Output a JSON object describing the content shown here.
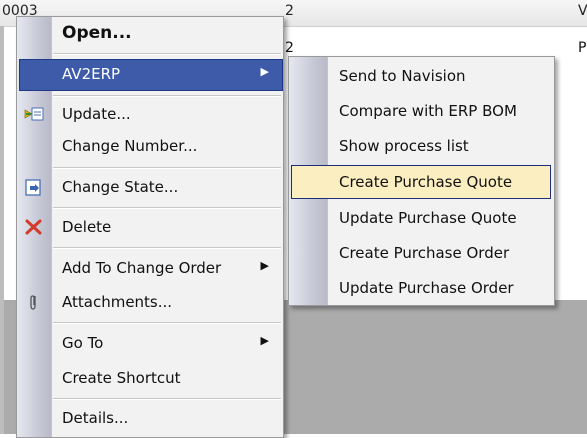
{
  "background": {
    "header_cells": [
      "0003",
      "2",
      "V"
    ],
    "row_texts": [
      "2",
      "P"
    ]
  },
  "context_menu": {
    "items": [
      {
        "label": "Open...",
        "icon": null,
        "bold": true
      },
      {
        "label": "AV2ERP",
        "has_submenu": true,
        "selected": true
      },
      {
        "label": "Update...",
        "icon": "update-icon"
      },
      {
        "label": "Change Number..."
      },
      {
        "label": "Change State...",
        "icon": "change-state-icon"
      },
      {
        "label": "Delete",
        "icon": "delete-x-icon"
      },
      {
        "label": "Add To Change Order",
        "has_submenu": true
      },
      {
        "label": "Attachments...",
        "icon": "paperclip-icon"
      },
      {
        "label": "Go To",
        "has_submenu": true
      },
      {
        "label": "Create Shortcut"
      },
      {
        "label": "Details..."
      }
    ]
  },
  "submenu": {
    "items": [
      {
        "label": "Send to Navision"
      },
      {
        "label": "Compare with ERP BOM"
      },
      {
        "label": "Show process list"
      },
      {
        "label": "Create Purchase Quote",
        "highlighted": true
      },
      {
        "label": "Update Purchase Quote"
      },
      {
        "label": "Create Purchase Order"
      },
      {
        "label": "Update Purchase Order"
      }
    ]
  },
  "colors": {
    "selected_bg": "#3d5ba9",
    "hover_bg": "#fbeec0",
    "menu_bg": "#f2f2f2"
  }
}
